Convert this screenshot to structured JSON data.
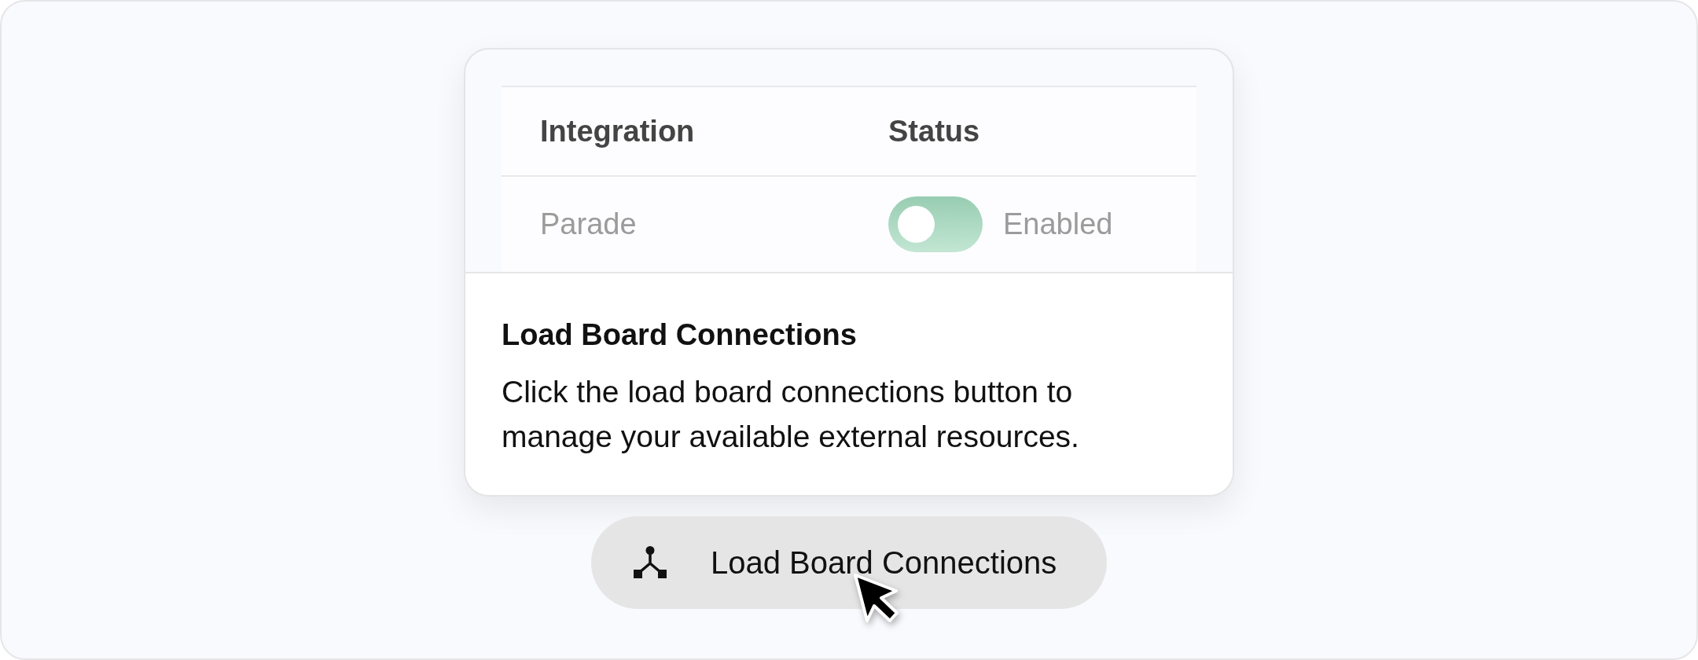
{
  "table": {
    "columns": [
      "Integration",
      "Status"
    ],
    "rows": [
      {
        "integration": "Parade",
        "status": {
          "on": true,
          "label": "Enabled"
        }
      }
    ]
  },
  "info": {
    "title": "Load Board Connections",
    "text": "Click the load board connections button to manage your available external resources."
  },
  "button": {
    "label": "Load Board Connections"
  }
}
